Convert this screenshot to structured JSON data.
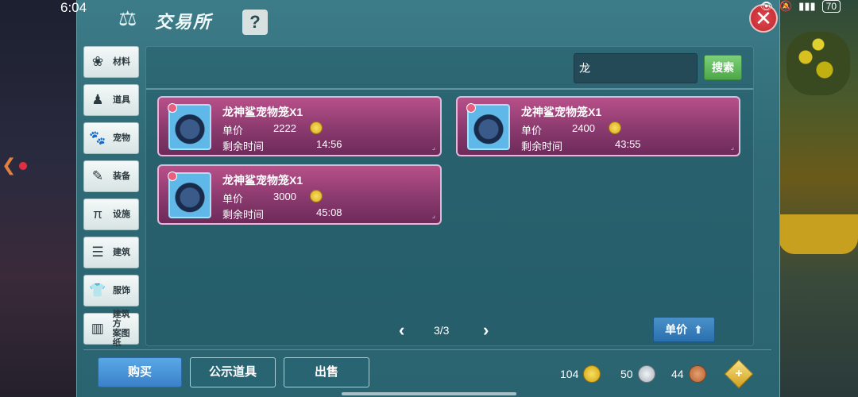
{
  "status_bar": {
    "time": "6:04",
    "battery": "70"
  },
  "window": {
    "title": "交易所",
    "help_label": "?",
    "close_label": "✕"
  },
  "sidebar": {
    "items": [
      {
        "label": "材料",
        "icon": "materials-icon"
      },
      {
        "label": "道具",
        "icon": "item-icon"
      },
      {
        "label": "宠物",
        "icon": "paw-icon"
      },
      {
        "label": "装备",
        "icon": "equipment-icon"
      },
      {
        "label": "设施",
        "icon": "facility-icon"
      },
      {
        "label": "建筑",
        "icon": "building-icon"
      },
      {
        "label": "服饰",
        "icon": "clothing-icon"
      },
      {
        "label": "建筑方\n案图纸",
        "icon": "blueprint-icon"
      }
    ]
  },
  "search": {
    "value": "龙",
    "button_label": "搜索"
  },
  "listings": [
    {
      "name": "龙神鲨宠物笼X1",
      "price_label": "单价",
      "price": "2222",
      "time_label": "剩余时间",
      "time": "14:56"
    },
    {
      "name": "龙神鲨宠物笼X1",
      "price_label": "单价",
      "price": "2400",
      "time_label": "剩余时间",
      "time": "43:55"
    },
    {
      "name": "龙神鲨宠物笼X1",
      "price_label": "单价",
      "price": "3000",
      "time_label": "剩余时间",
      "time": "45:08"
    }
  ],
  "pager": {
    "text": "3/3"
  },
  "sort": {
    "label": "单价"
  },
  "bottom": {
    "buy_label": "购买",
    "public_label": "公示道具",
    "sell_label": "出售"
  },
  "currencies": {
    "gold": "104",
    "silver": "50",
    "bronze": "44"
  },
  "colors": {
    "panel": "#2f6a76",
    "card": "#8a3a6e",
    "buy_button": "#3a80c8",
    "search_button": "#4ca848",
    "close": "#c02830"
  }
}
